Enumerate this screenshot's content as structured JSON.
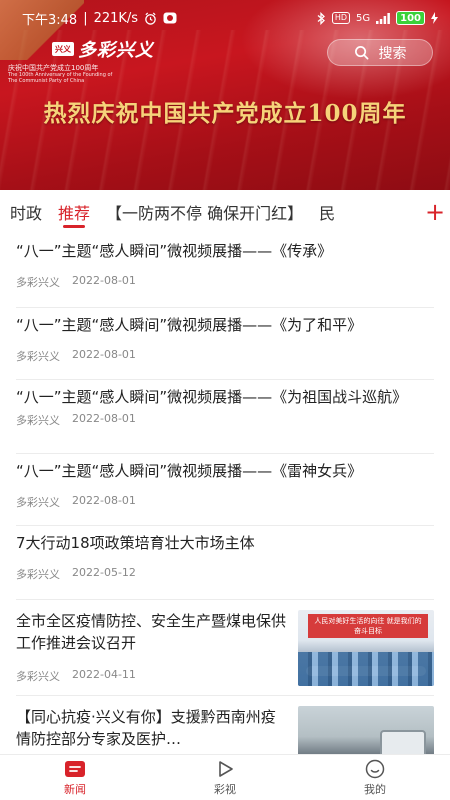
{
  "status_bar": {
    "time": "下午3:48",
    "network_speed": "221K/s",
    "signal": "5G",
    "hd_label": "HD",
    "battery": "100"
  },
  "header": {
    "logo_seal": "兴义",
    "logo_text": "多彩兴义",
    "logo_sub_cn": "庆祝中国共产党成立100周年",
    "logo_sub_en": "The 100th Anniversary of the Founding of The Communist Party of China",
    "search_label": "搜索",
    "banner_slogan": "热烈庆祝中国共产党成立100周年",
    "accent_color": "#d8232a"
  },
  "tabs": [
    {
      "label": "时政",
      "active": false
    },
    {
      "label": "推荐",
      "active": true
    },
    {
      "label": "【一防两不停 确保开门红】",
      "active": false
    },
    {
      "label": "民",
      "active": false
    }
  ],
  "add_tab_label": "+",
  "news": [
    {
      "title": "“八一”主题“感人瞬间”微视频展播——《传承》",
      "source": "多彩兴义",
      "date": "2022-08-01"
    },
    {
      "title": "“八一”主题“感人瞬间”微视频展播——《为了和平》",
      "source": "多彩兴义",
      "date": "2022-08-01"
    },
    {
      "title": "“八一”主题“感人瞬间”微视频展播——《为祖国战斗巡航》",
      "source": "多彩兴义",
      "date": "2022-08-01"
    },
    {
      "title": "“八一”主题“感人瞬间”微视频展播——《雷神女兵》",
      "source": "多彩兴义",
      "date": "2022-08-01"
    },
    {
      "title": "7大行动18项政策培育壮大市场主体",
      "source": "多彩兴义",
      "date": "2022-05-12"
    },
    {
      "title": "全市全区疫情防控、安全生产暨煤电保供工作推进会议召开",
      "source": "多彩兴义",
      "date": "2022-04-11",
      "thumb_caption": "人民对美好生活的向往 就是我们的奋斗目标"
    },
    {
      "title": "【同心抗疫·兴义有你】支援黔西南州疫情防控部分专家及医护…",
      "source": "",
      "date": ""
    }
  ],
  "bottom_nav": [
    {
      "label": "新闻",
      "icon": "news-icon",
      "active": true
    },
    {
      "label": "彩视",
      "icon": "play-icon",
      "active": false
    },
    {
      "label": "我的",
      "icon": "profile-icon",
      "active": false
    }
  ]
}
